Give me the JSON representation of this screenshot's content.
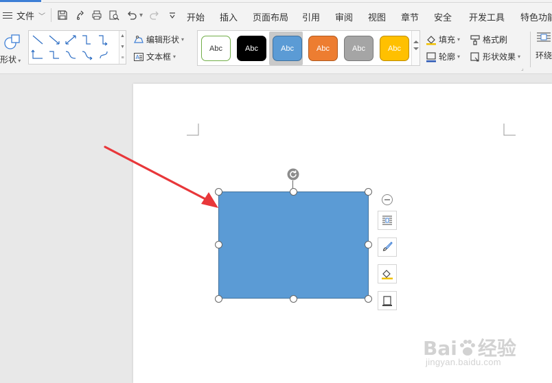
{
  "menubar": {
    "file_label": "文件",
    "tabs": [
      {
        "label": "开始"
      },
      {
        "label": "插入"
      },
      {
        "label": "页面布局"
      },
      {
        "label": "引用"
      },
      {
        "label": "审阅"
      },
      {
        "label": "视图"
      },
      {
        "label": "章节"
      },
      {
        "label": "安全"
      },
      {
        "label": "开发工具"
      },
      {
        "label": "特色功能"
      }
    ]
  },
  "ribbon": {
    "shape_label": "形状",
    "edit_shape_label": "编辑形状",
    "textbox_label": "文本框",
    "style_samples": [
      {
        "text": "Abc",
        "fill": "#ffffff",
        "border": "#70ad47",
        "color": "#333333"
      },
      {
        "text": "Abc",
        "fill": "#000000",
        "border": "#000000",
        "color": "#ffffff"
      },
      {
        "text": "Abc",
        "fill": "#5b9bd5",
        "border": "#41719c",
        "color": "#ffffff"
      },
      {
        "text": "Abc",
        "fill": "#ed7d31",
        "border": "#ae5a21",
        "color": "#ffffff"
      },
      {
        "text": "Abc",
        "fill": "#a5a5a5",
        "border": "#787878",
        "color": "#ffffff"
      },
      {
        "text": "Abc",
        "fill": "#ffc000",
        "border": "#bc8c00",
        "color": "#ffffff"
      }
    ],
    "fill_label": "填充",
    "outline_label": "轮廓",
    "format_painter_label": "格式刷",
    "shape_effects_label": "形状效果",
    "wrap_label": "环绕"
  },
  "shape": {
    "fill": "#5b9bd5",
    "border": "#41719c"
  },
  "annotation": {
    "arrow_color": "#e8373a"
  },
  "watermark": {
    "logo": "Bai",
    "logo_suffix": "经验",
    "url": "jingyan.baidu.com"
  },
  "colors": {
    "accent": "#3e7fd6",
    "ribbon_bg": "#f3f3f3"
  }
}
